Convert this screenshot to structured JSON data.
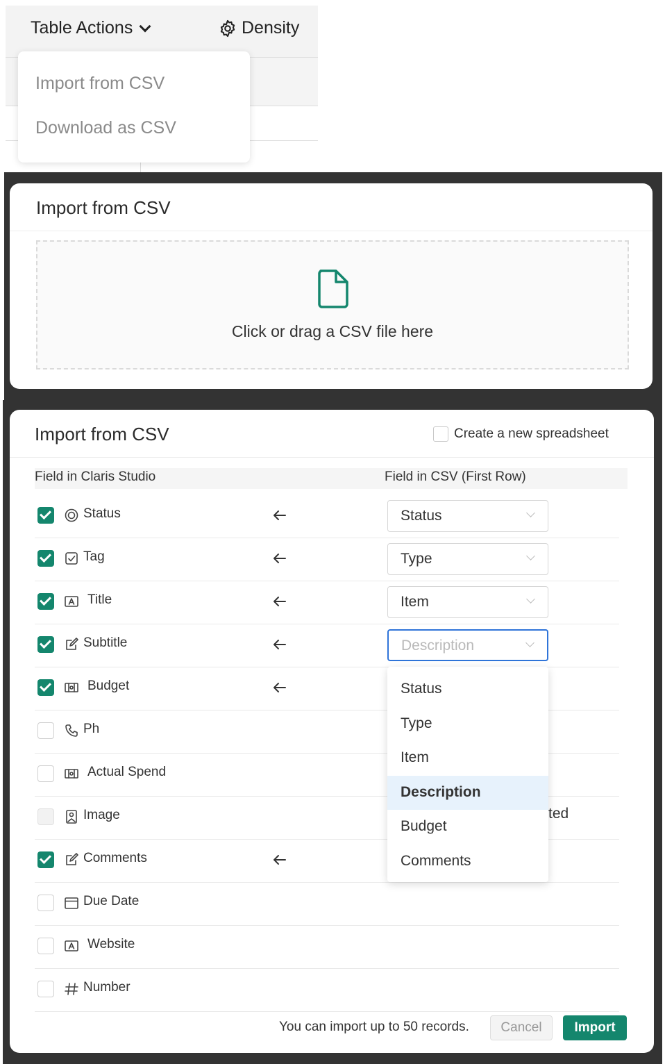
{
  "table_actions": {
    "button_label": "Table Actions",
    "density_label": "Density",
    "menu_items": [
      "Import from CSV",
      "Download as CSV"
    ]
  },
  "upload_dialog": {
    "title": "Import from CSV",
    "dropzone_text": "Click or drag a CSV file here",
    "icon": "file-icon"
  },
  "mapping_dialog": {
    "title": "Import from CSV",
    "new_spreadsheet_label": "Create a new spreadsheet",
    "col_studio": "Field in Claris Studio",
    "col_csv": "Field in CSV (First Row)",
    "rows": [
      {
        "label": "Status",
        "checked": true,
        "icon": "status-icon",
        "mapped": "Status"
      },
      {
        "label": "Tag",
        "checked": true,
        "icon": "tag-icon",
        "mapped": "Type"
      },
      {
        "label": "Title",
        "checked": true,
        "icon": "text-field-icon",
        "mapped": "Item"
      },
      {
        "label": "Subtitle",
        "checked": true,
        "icon": "edit-icon",
        "mapped": "Description",
        "active": true
      },
      {
        "label": "Budget",
        "checked": true,
        "icon": "currency-icon",
        "mapped": ""
      },
      {
        "label": "Ph",
        "checked": false,
        "icon": "phone-icon",
        "mapped": ""
      },
      {
        "label": "Actual Spend",
        "checked": false,
        "icon": "currency-icon",
        "mapped": ""
      },
      {
        "label": "Image",
        "checked": false,
        "disabled": true,
        "icon": "image-icon",
        "mapped": "",
        "note": "ted"
      },
      {
        "label": "Comments",
        "checked": true,
        "icon": "edit-icon",
        "mapped": ""
      },
      {
        "label": "Due Date",
        "checked": false,
        "icon": "calendar-icon",
        "mapped": ""
      },
      {
        "label": "Website",
        "checked": false,
        "icon": "text-field-icon",
        "mapped": ""
      },
      {
        "label": "Number",
        "checked": false,
        "icon": "hash-icon",
        "mapped": ""
      }
    ],
    "dropdown_options": [
      "Status",
      "Type",
      "Item",
      "Description",
      "Budget",
      "Comments"
    ],
    "dropdown_highlighted": "Description",
    "footer_note": "You can import up to 50 records.",
    "cancel_label": "Cancel",
    "import_label": "Import",
    "accent_color": "#14866d",
    "focus_color": "#2f74d9"
  }
}
